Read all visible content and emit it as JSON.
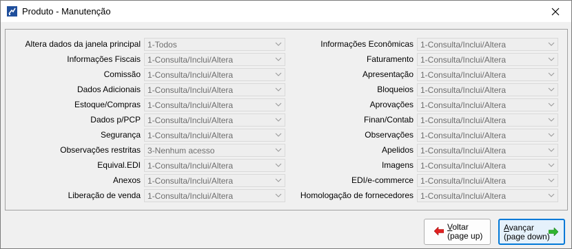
{
  "window": {
    "title": "Produto - Manutenção"
  },
  "left_fields": [
    {
      "label": "Altera dados da janela principal",
      "value": "1-Todos"
    },
    {
      "label": "Informações Fiscais",
      "value": "1-Consulta/Inclui/Altera"
    },
    {
      "label": "Comissão",
      "value": "1-Consulta/Inclui/Altera"
    },
    {
      "label": "Dados Adicionais",
      "value": "1-Consulta/Inclui/Altera"
    },
    {
      "label": "Estoque/Compras",
      "value": "1-Consulta/Inclui/Altera"
    },
    {
      "label": "Dados p/PCP",
      "value": "1-Consulta/Inclui/Altera"
    },
    {
      "label": "Segurança",
      "value": "1-Consulta/Inclui/Altera"
    },
    {
      "label": "Observações restritas",
      "value": "3-Nenhum acesso"
    },
    {
      "label": "Equival.EDI",
      "value": "1-Consulta/Inclui/Altera"
    },
    {
      "label": "Anexos",
      "value": "1-Consulta/Inclui/Altera"
    },
    {
      "label": "Liberação de venda",
      "value": "1-Consulta/Inclui/Altera"
    }
  ],
  "right_fields": [
    {
      "label": "Informações Econômicas",
      "value": "1-Consulta/Inclui/Altera"
    },
    {
      "label": "Faturamento",
      "value": "1-Consulta/Inclui/Altera"
    },
    {
      "label": "Apresentação",
      "value": "1-Consulta/Inclui/Altera"
    },
    {
      "label": "Bloqueios",
      "value": "1-Consulta/Inclui/Altera"
    },
    {
      "label": "Aprovações",
      "value": "1-Consulta/Inclui/Altera"
    },
    {
      "label": "Finan/Contab",
      "value": "1-Consulta/Inclui/Altera"
    },
    {
      "label": "Observações",
      "value": "1-Consulta/Inclui/Altera"
    },
    {
      "label": "Apelidos",
      "value": "1-Consulta/Inclui/Altera"
    },
    {
      "label": "Imagens",
      "value": "1-Consulta/Inclui/Altera"
    },
    {
      "label": "EDI/e-commerce",
      "value": "1-Consulta/Inclui/Altera"
    },
    {
      "label": "Homologação de fornecedores",
      "value": "1-Consulta/Inclui/Altera"
    }
  ],
  "buttons": {
    "back": {
      "key": "V",
      "rest": "oltar",
      "line2": "(page up)"
    },
    "next": {
      "key": "A",
      "rest": "vançar",
      "line2": "(page down)"
    }
  },
  "colors": {
    "accent": "#0078d7",
    "back_arrow": "#e02020",
    "next_arrow": "#2fb52f"
  },
  "icons": {
    "app": "app-icon",
    "close": "close-icon",
    "back": "arrow-left-icon",
    "next": "arrow-right-icon",
    "dropdown": "chevron-down-icon"
  }
}
